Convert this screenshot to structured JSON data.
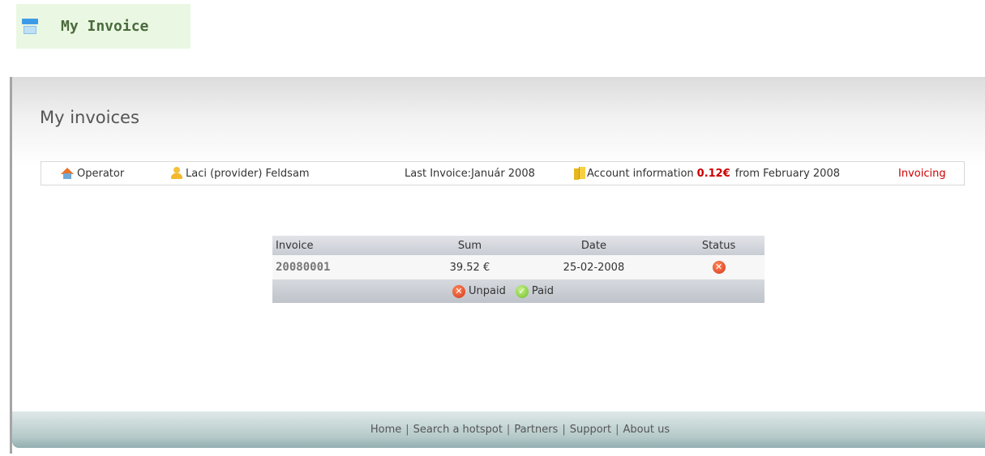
{
  "top_tab": {
    "title": "My Invoice",
    "icon": "window-icon"
  },
  "page": {
    "title": "My invoices"
  },
  "info_bar": {
    "operator": "Operator",
    "user": "Laci (provider) Feldsam",
    "last_invoice": "Last Invoice:Január 2008",
    "account_information": "Account information",
    "amount": "0.12€",
    "from": "from February 2008",
    "invoicing": "Invoicing",
    "accent_color": "#cc0000"
  },
  "table": {
    "headers": {
      "invoice": "Invoice",
      "sum": "Sum",
      "date": "Date",
      "status": "Status"
    },
    "rows": [
      {
        "invoice": "20080001",
        "sum": "39.52 €",
        "date": "25-02-2008",
        "status": "unpaid"
      }
    ],
    "legend": {
      "unpaid": "Unpaid",
      "paid": "Paid"
    }
  },
  "footer": {
    "links": [
      "Home",
      "Search a hotspot",
      "Partners",
      "Support",
      "About us"
    ],
    "separator": "|"
  }
}
